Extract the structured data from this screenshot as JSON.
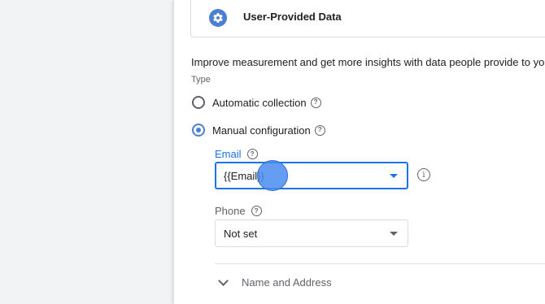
{
  "section": {
    "title": "User-Provided Data",
    "icon": "gear-icon"
  },
  "description": "Improve measurement and get more insights with data people provide to your business",
  "type_label": "Type",
  "options": [
    {
      "label": "Automatic collection",
      "selected": false
    },
    {
      "label": "Manual configuration",
      "selected": true
    }
  ],
  "fields": {
    "email": {
      "label": "Email",
      "value": "{{Email}}"
    },
    "phone": {
      "label": "Phone",
      "value": "Not set"
    }
  },
  "expander": {
    "label": "Name and Address"
  },
  "colors": {
    "accent": "#1a73e8",
    "icon_bg": "#4a7fd4"
  }
}
